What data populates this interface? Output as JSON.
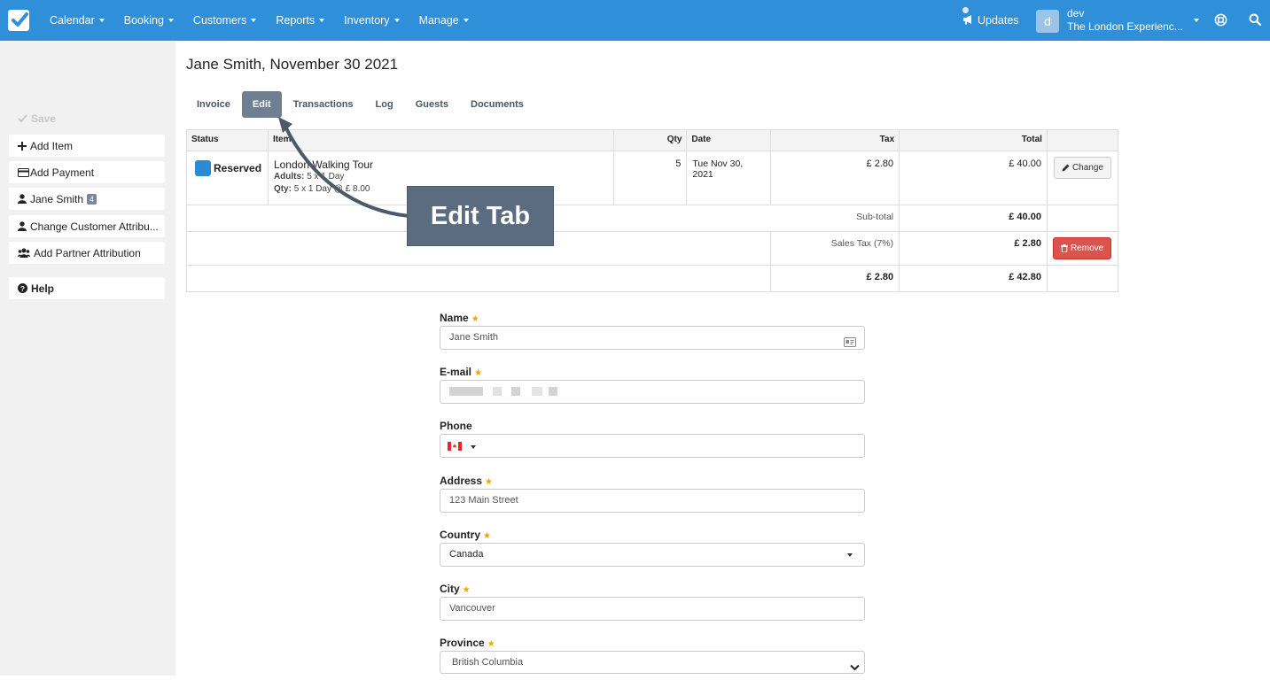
{
  "nav": {
    "menu": [
      "Calendar",
      "Booking",
      "Customers",
      "Reports",
      "Inventory",
      "Manage"
    ],
    "updates": "Updates",
    "avatar_letter": "d",
    "user_name": "dev",
    "company": "The London Experienc..."
  },
  "sidebar": {
    "save": "Save",
    "add_item": "Add Item",
    "add_payment": "Add Payment",
    "customer": "Jane Smith",
    "customer_count": "4",
    "change_attr": "Change Customer Attribu...",
    "partner_attr": "Add Partner Attribution",
    "help": "Help"
  },
  "page_title": "Jane Smith, November 30 2021",
  "tabs": [
    "Invoice",
    "Edit",
    "Transactions",
    "Log",
    "Guests",
    "Documents"
  ],
  "active_tab": "Edit",
  "invoice": {
    "headers": {
      "status": "Status",
      "item": "Item",
      "qty": "Qty",
      "date": "Date",
      "tax": "Tax",
      "total": "Total"
    },
    "row": {
      "status": "Reserved",
      "item": "London Walking Tour",
      "adults_label": "Adults:",
      "adults": "5 x 1 Day",
      "qty_label": "Qty:",
      "qty_detail": "5 x 1 Day @ £ 8.00",
      "qty": "5",
      "date": "Tue Nov 30, 2021",
      "tax": "£ 2.80",
      "total": "£ 40.00",
      "change_label": "Change"
    },
    "subtotal_label": "Sub-total",
    "subtotal": "£ 40.00",
    "sales_tax_label": "Sales Tax (7%)",
    "sales_tax": "£ 2.80",
    "remove_label": "Remove",
    "grand_tax": "£ 2.80",
    "grand_total": "£ 42.80"
  },
  "callout": "Edit Tab",
  "form": {
    "name_label": "Name",
    "name_value": "Jane Smith",
    "email_label": "E-mail",
    "phone_label": "Phone",
    "address_label": "Address",
    "address_value": "123 Main Street",
    "country_label": "Country",
    "country_value": "Canada",
    "city_label": "City",
    "city_value": "Vancouver",
    "province_label": "Province",
    "province_value": "British Columbia"
  },
  "colors": {
    "navbar": "#2f8fd8",
    "active_tab": "#6f7f91",
    "reserved": "#2a8ad4",
    "remove": "#d9534f",
    "required_star": "#f0a500"
  }
}
